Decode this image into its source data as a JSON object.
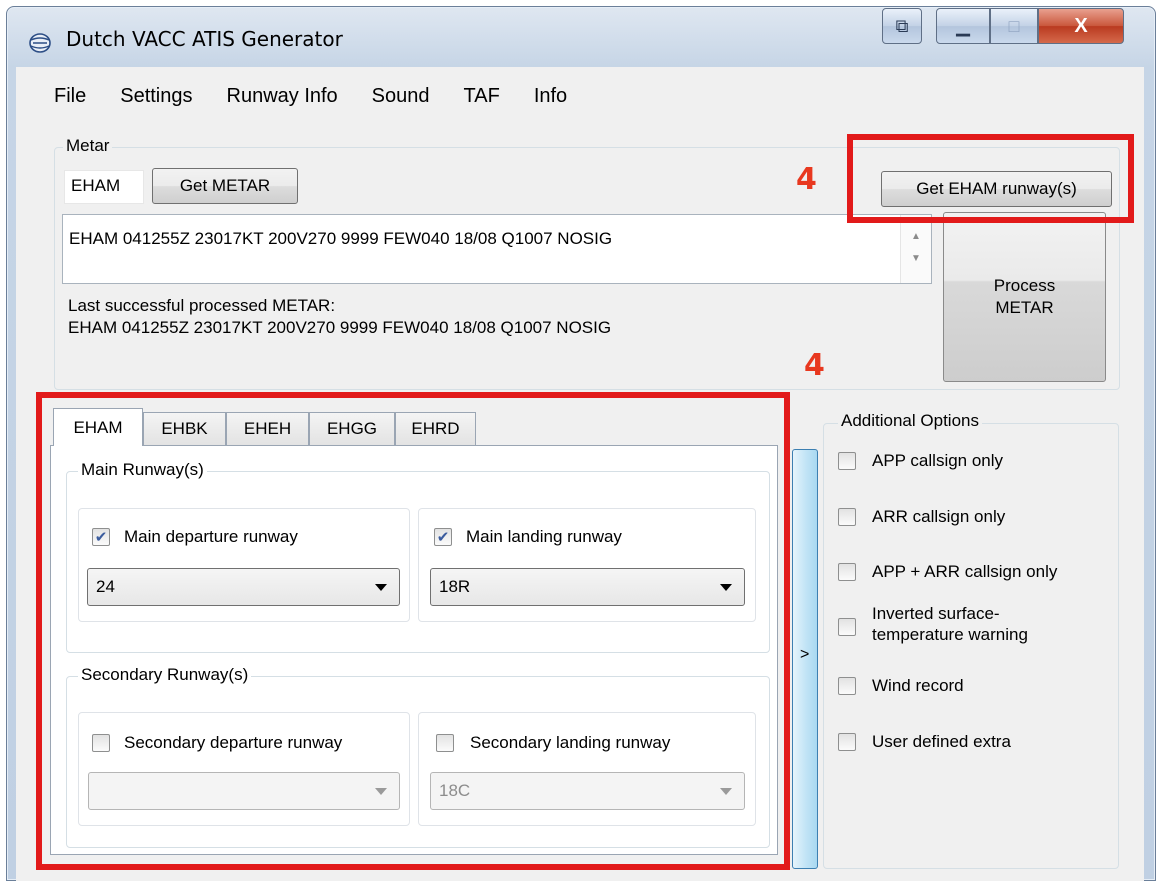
{
  "window": {
    "title": "Dutch VACC ATIS Generator"
  },
  "menu": [
    "File",
    "Settings",
    "Runway Info",
    "Sound",
    "TAF",
    "Info"
  ],
  "metar": {
    "group_label": "Metar",
    "station_value": "EHAM",
    "get_metar_label": "Get METAR",
    "get_runways_label": "Get EHAM runway(s)",
    "metar_text": "EHAM 041255Z 23017KT 200V270 9999 FEW040 18/08 Q1007 NOSIG",
    "last_label": "Last successful processed METAR:",
    "last_value": "EHAM 041255Z 23017KT 200V270 9999 FEW040 18/08 Q1007 NOSIG",
    "process_label": "Process METAR"
  },
  "annotations": {
    "top_number": "4",
    "middle_number": "4",
    "color": "#e21a1a"
  },
  "tabs": [
    "EHAM",
    "EHBK",
    "EHEH",
    "EHGG",
    "EHRD"
  ],
  "active_tab": "EHAM",
  "main_runways": {
    "group_label": "Main Runway(s)",
    "departure": {
      "label": "Main departure runway",
      "checked": true,
      "value": "24"
    },
    "landing": {
      "label": "Main landing runway",
      "checked": true,
      "value": "18R"
    }
  },
  "secondary_runways": {
    "group_label": "Secondary Runway(s)",
    "departure": {
      "label": "Secondary departure runway",
      "checked": false,
      "value": ""
    },
    "landing": {
      "label": "Secondary landing runway",
      "checked": false,
      "value": "18C"
    }
  },
  "expander_label": ">",
  "additional_options": {
    "group_label": "Additional Options",
    "items": [
      {
        "label": "APP callsign only",
        "checked": false
      },
      {
        "label": "ARR callsign only",
        "checked": false
      },
      {
        "label": "APP + ARR callsign only",
        "checked": false
      },
      {
        "label": "Inverted surface-temperature warning",
        "checked": false
      },
      {
        "label": "Wind record",
        "checked": false
      },
      {
        "label": "User defined extra",
        "checked": false
      }
    ]
  },
  "icons": {
    "app": "app-globe-icon",
    "check": "checkmark-icon",
    "dropdown": "dropdown-arrow-icon"
  },
  "colors": {
    "accent_blue": "#3b5c9e",
    "annotation_red": "#e21a1a"
  }
}
